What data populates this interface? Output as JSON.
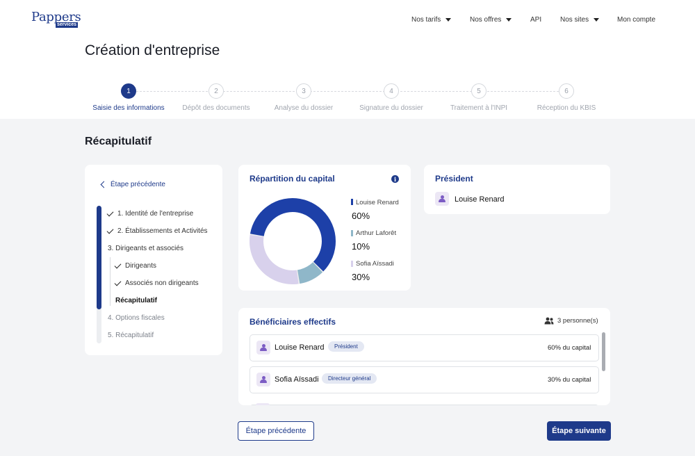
{
  "brand": {
    "name": "Pappers",
    "sub": "services"
  },
  "nav": [
    {
      "label": "Nos tarifs",
      "dropdown": true
    },
    {
      "label": "Nos offres",
      "dropdown": true
    },
    {
      "label": "API",
      "dropdown": false
    },
    {
      "label": "Nos sites",
      "dropdown": true
    },
    {
      "label": "Mon compte",
      "dropdown": false
    }
  ],
  "page_title": "Création d'entreprise",
  "steps": [
    {
      "num": "1",
      "label": "Saisie des informations",
      "active": true
    },
    {
      "num": "2",
      "label": "Dépôt des documents",
      "active": false
    },
    {
      "num": "3",
      "label": "Analyse du dossier",
      "active": false
    },
    {
      "num": "4",
      "label": "Signature du dossier",
      "active": false
    },
    {
      "num": "5",
      "label": "Traitement à l'INPI",
      "active": false
    },
    {
      "num": "6",
      "label": "Réception du KBIS",
      "active": false
    }
  ],
  "section_title": "Récapitulatif",
  "sidebar": {
    "back_label": "Étape précédente",
    "progress_fraction": 0.75,
    "items": [
      {
        "label": "1. Identité de l'entreprise",
        "done": true
      },
      {
        "label": "2. Établissements et Activités",
        "done": true
      },
      {
        "label": "3. Dirigeants et associés",
        "done": false
      },
      {
        "label": "Dirigeants",
        "done": true
      },
      {
        "label": "Associés non dirigeants",
        "done": true
      },
      {
        "label": "Récapitulatif",
        "done": false,
        "current": true
      },
      {
        "label": "4. Options fiscales",
        "done": false
      },
      {
        "label": "5. Récapitulatif",
        "done": false
      }
    ]
  },
  "capital": {
    "title": "Répartition du capital",
    "info_icon": "info-icon",
    "entries": [
      {
        "name": "Louise Renard",
        "percent": "60%",
        "value": 60,
        "color": "#1d40a8"
      },
      {
        "name": "Arthur Laforêt",
        "percent": "10%",
        "value": 10,
        "color": "#8fb7c9"
      },
      {
        "name": "Sofia Aïssadi",
        "percent": "30%",
        "value": 30,
        "color": "#d8d1ec"
      }
    ]
  },
  "president": {
    "title": "Président",
    "name": "Louise Renard"
  },
  "beneficiaires": {
    "title": "Bénéficiaires effectifs",
    "count_label": "3 personne(s)",
    "rows": [
      {
        "name": "Louise Renard",
        "role": "Président",
        "capital": "60% du capital"
      },
      {
        "name": "Sofia Aïssadi",
        "role": "Directeur général",
        "capital": "30% du capital"
      }
    ]
  },
  "footer": {
    "prev_label": "Étape précédente",
    "next_label": "Étape suivante"
  }
}
